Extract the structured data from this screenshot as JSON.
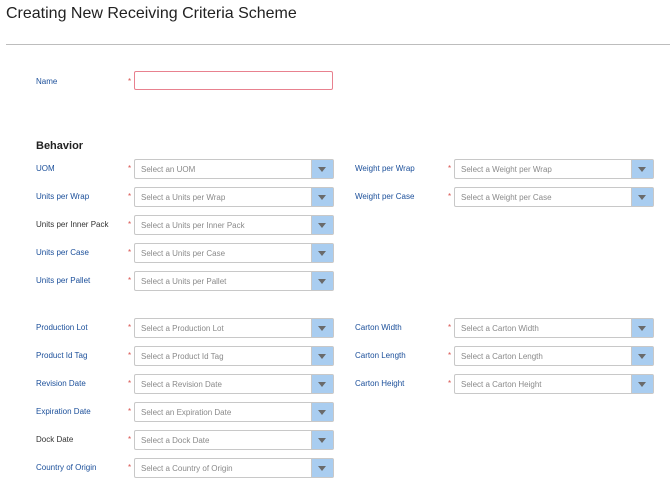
{
  "page": {
    "title": "Creating New Receiving Criteria Scheme"
  },
  "name_field": {
    "label": "Name",
    "required_mark": "*",
    "value": ""
  },
  "behavior": {
    "title": "Behavior",
    "left_fields": [
      {
        "label": "UOM",
        "placeholder": "Select an UOM"
      },
      {
        "label": "Units per Wrap",
        "placeholder": "Select a Units per Wrap"
      },
      {
        "label": "Units per Inner Pack",
        "placeholder": "Select a Units per Inner Pack"
      },
      {
        "label": "Units per Case",
        "placeholder": "Select a Units per Case"
      },
      {
        "label": "Units per Pallet",
        "placeholder": "Select a Units per Pallet"
      }
    ],
    "right_fields": [
      {
        "label": "Weight per Wrap",
        "placeholder": "Select a Weight per Wrap"
      },
      {
        "label": "Weight per Case",
        "placeholder": "Select a Weight per Case"
      }
    ]
  },
  "tracking": {
    "left_fields": [
      {
        "label": "Production Lot",
        "placeholder": "Select a Production Lot"
      },
      {
        "label": "Product Id Tag",
        "placeholder": "Select a Product Id Tag"
      },
      {
        "label": "Revision Date",
        "placeholder": "Select a Revision Date"
      },
      {
        "label": "Expiration Date",
        "placeholder": "Select an Expiration Date"
      },
      {
        "label": "Dock Date",
        "placeholder": "Select a Dock Date"
      },
      {
        "label": "Country of Origin",
        "placeholder": "Select a Country of Origin"
      }
    ],
    "right_fields": [
      {
        "label": "Carton Width",
        "placeholder": "Select a Carton Width"
      },
      {
        "label": "Carton Length",
        "placeholder": "Select a Carton Length"
      },
      {
        "label": "Carton Height",
        "placeholder": "Select a Carton Height"
      }
    ]
  },
  "colors": {
    "label_blue": "#1b4f9a",
    "required_red": "#d9534f",
    "dropdown_button": "#a9cdf0"
  }
}
